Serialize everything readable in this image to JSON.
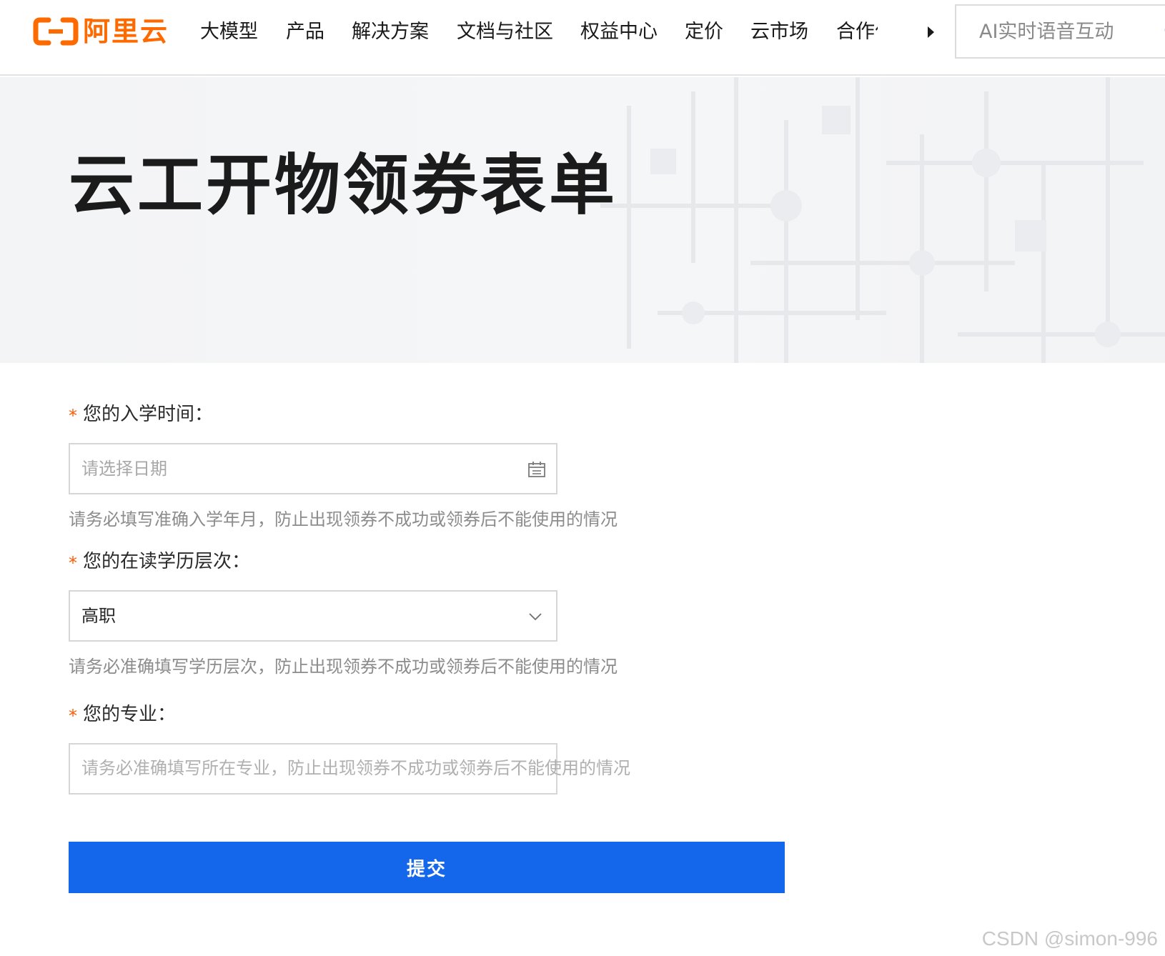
{
  "brand": {
    "name": "阿里云",
    "accent_color": "#ff6a00"
  },
  "nav": {
    "items": [
      {
        "label": "大模型"
      },
      {
        "label": "产品"
      },
      {
        "label": "解决方案"
      },
      {
        "label": "文档与社区"
      },
      {
        "label": "权益中心"
      },
      {
        "label": "定价"
      },
      {
        "label": "云市场"
      },
      {
        "label": "合作伙伴"
      }
    ],
    "more_icon": "caret-right-icon"
  },
  "search": {
    "placeholder": "AI实时语音互动",
    "icon": "search-icon"
  },
  "hero": {
    "title": "云工开物领券表单"
  },
  "form": {
    "enroll_time": {
      "label": "您的入学时间：",
      "placeholder": "请选择日期",
      "hint": "请务必填写准确入学年月，防止出现领券不成功或领券后不能使用的情况",
      "icon": "calendar-icon"
    },
    "education_level": {
      "label": "您的在读学历层次：",
      "value": "高职",
      "hint": "请务必准确填写学历层次，防止出现领券不成功或领券后不能使用的情况",
      "icon": "chevron-down-icon"
    },
    "major": {
      "label": "您的专业：",
      "placeholder": "请务必准确填写所在专业，防止出现领券不成功或领券后不能使用的情况"
    },
    "required_mark": "*",
    "submit_label": "提交",
    "submit_color": "#1466eb"
  },
  "watermark": "CSDN @simon-996"
}
